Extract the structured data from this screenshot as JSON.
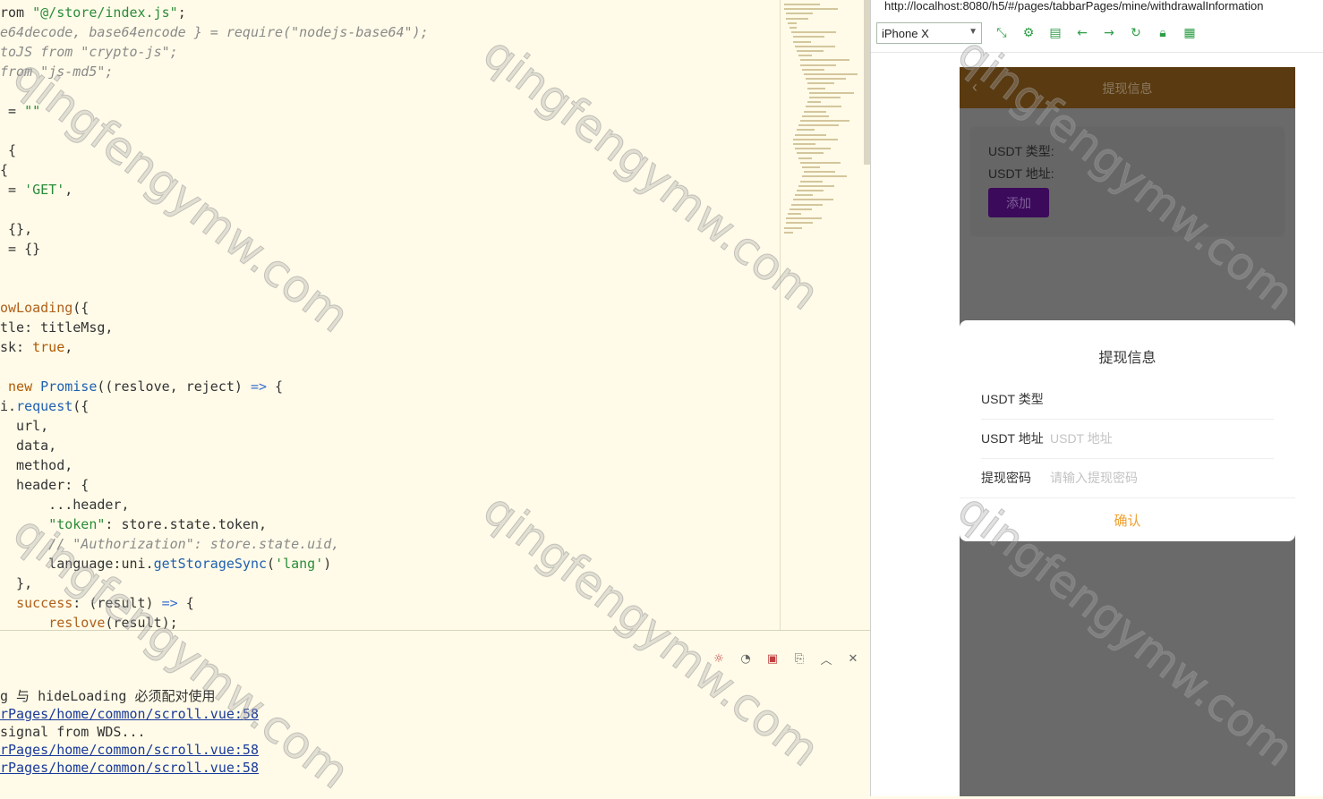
{
  "editor": {
    "lines": [
      {
        "parts": [
          [
            "plain",
            "rom "
          ],
          [
            "str",
            "\"@/store/index.js\""
          ],
          [
            "plain",
            ";"
          ]
        ]
      },
      {
        "parts": [
          [
            "cmt",
            "e64decode, base64encode } = require(\"nodejs-base64\");"
          ]
        ]
      },
      {
        "parts": [
          [
            "cmt",
            "toJS from \"crypto-js\";"
          ]
        ]
      },
      {
        "parts": [
          [
            "cmt",
            "from \"js-md5\";"
          ]
        ]
      },
      {
        "parts": [
          [
            "plain",
            ""
          ]
        ]
      },
      {
        "parts": [
          [
            "plain",
            " = "
          ],
          [
            "str",
            "\"\""
          ]
        ]
      },
      {
        "parts": [
          [
            "plain",
            ""
          ]
        ]
      },
      {
        "parts": [
          [
            "plain",
            " {"
          ]
        ]
      },
      {
        "parts": [
          [
            "plain",
            "{"
          ]
        ]
      },
      {
        "parts": [
          [
            "plain",
            " = "
          ],
          [
            "str",
            "'GET'"
          ],
          [
            "plain",
            ","
          ]
        ]
      },
      {
        "parts": [
          [
            "plain",
            ""
          ]
        ]
      },
      {
        "parts": [
          [
            "plain",
            " {},"
          ]
        ]
      },
      {
        "parts": [
          [
            "plain",
            " = {}"
          ]
        ]
      },
      {
        "parts": [
          [
            "plain",
            ""
          ]
        ]
      },
      {
        "parts": [
          [
            "plain",
            ""
          ]
        ]
      },
      {
        "parts": [
          [
            "prop",
            "owLoading"
          ],
          [
            "plain",
            "({"
          ]
        ]
      },
      {
        "parts": [
          [
            "plain",
            "tle: titleMsg,"
          ]
        ]
      },
      {
        "parts": [
          [
            "plain",
            "sk: "
          ],
          [
            "kw",
            "true"
          ],
          [
            "plain",
            ","
          ]
        ]
      },
      {
        "parts": [
          [
            "plain",
            ""
          ]
        ]
      },
      {
        "parts": [
          [
            "plain",
            " "
          ],
          [
            "kw",
            "new"
          ],
          [
            "plain",
            " "
          ],
          [
            "fn",
            "Promise"
          ],
          [
            "plain",
            "((reslove, reject) "
          ],
          [
            "arrow",
            "=>"
          ],
          [
            "plain",
            " {"
          ]
        ]
      },
      {
        "parts": [
          [
            "plain",
            "i."
          ],
          [
            "fn",
            "request"
          ],
          [
            "plain",
            "({"
          ]
        ]
      },
      {
        "parts": [
          [
            "plain",
            "  url,"
          ]
        ]
      },
      {
        "parts": [
          [
            "plain",
            "  data,"
          ]
        ]
      },
      {
        "parts": [
          [
            "plain",
            "  method,"
          ]
        ]
      },
      {
        "parts": [
          [
            "plain",
            "  header: {"
          ]
        ]
      },
      {
        "parts": [
          [
            "plain",
            "      ...header,"
          ]
        ]
      },
      {
        "parts": [
          [
            "plain",
            "      "
          ],
          [
            "str",
            "\"token\""
          ],
          [
            "plain",
            ": store.state.token,"
          ]
        ]
      },
      {
        "parts": [
          [
            "cmt",
            "      // \"Authorization\": store.state.uid,"
          ]
        ]
      },
      {
        "parts": [
          [
            "plain",
            "      language:uni."
          ],
          [
            "fn",
            "getStorageSync"
          ],
          [
            "plain",
            "("
          ],
          [
            "str",
            "'lang'"
          ],
          [
            "plain",
            ")"
          ]
        ]
      },
      {
        "parts": [
          [
            "plain",
            "  },"
          ]
        ]
      },
      {
        "parts": [
          [
            "plain",
            "  "
          ],
          [
            "prop",
            "success"
          ],
          [
            "plain",
            ": (result) "
          ],
          [
            "arrow",
            "=>"
          ],
          [
            "plain",
            " {"
          ]
        ]
      },
      {
        "parts": [
          [
            "plain",
            "      "
          ],
          [
            "prop",
            "reslove"
          ],
          [
            "plain",
            "(result);"
          ]
        ]
      }
    ]
  },
  "console": {
    "lines": [
      {
        "text": "g 与 hideLoading 必须配对使用",
        "link": false
      },
      {
        "text": "rPages/home/common/scroll.vue:58",
        "link": true
      },
      {
        "text": "signal from WDS...",
        "link": false
      },
      {
        "text": "rPages/home/common/scroll.vue:58",
        "link": true
      },
      {
        "text": "rPages/home/common/scroll.vue:58",
        "link": true
      }
    ]
  },
  "preview": {
    "url": "http://localhost:8080/h5/#/pages/tabbarPages/mine/withdrawalInformation",
    "device": "iPhone X",
    "nav_title": "提现信息",
    "card": {
      "type_label": "USDT 类型:",
      "address_label": "USDT 地址:",
      "add_button": "添加"
    },
    "sheet": {
      "title": "提现信息",
      "rows": [
        {
          "label": "USDT 类型",
          "placeholder": ""
        },
        {
          "label": "USDT 地址",
          "placeholder": "USDT 地址"
        },
        {
          "label": "提现密码",
          "placeholder": "请输入提现密码"
        }
      ],
      "confirm": "确认"
    }
  },
  "watermark": "qingfengymw.com"
}
